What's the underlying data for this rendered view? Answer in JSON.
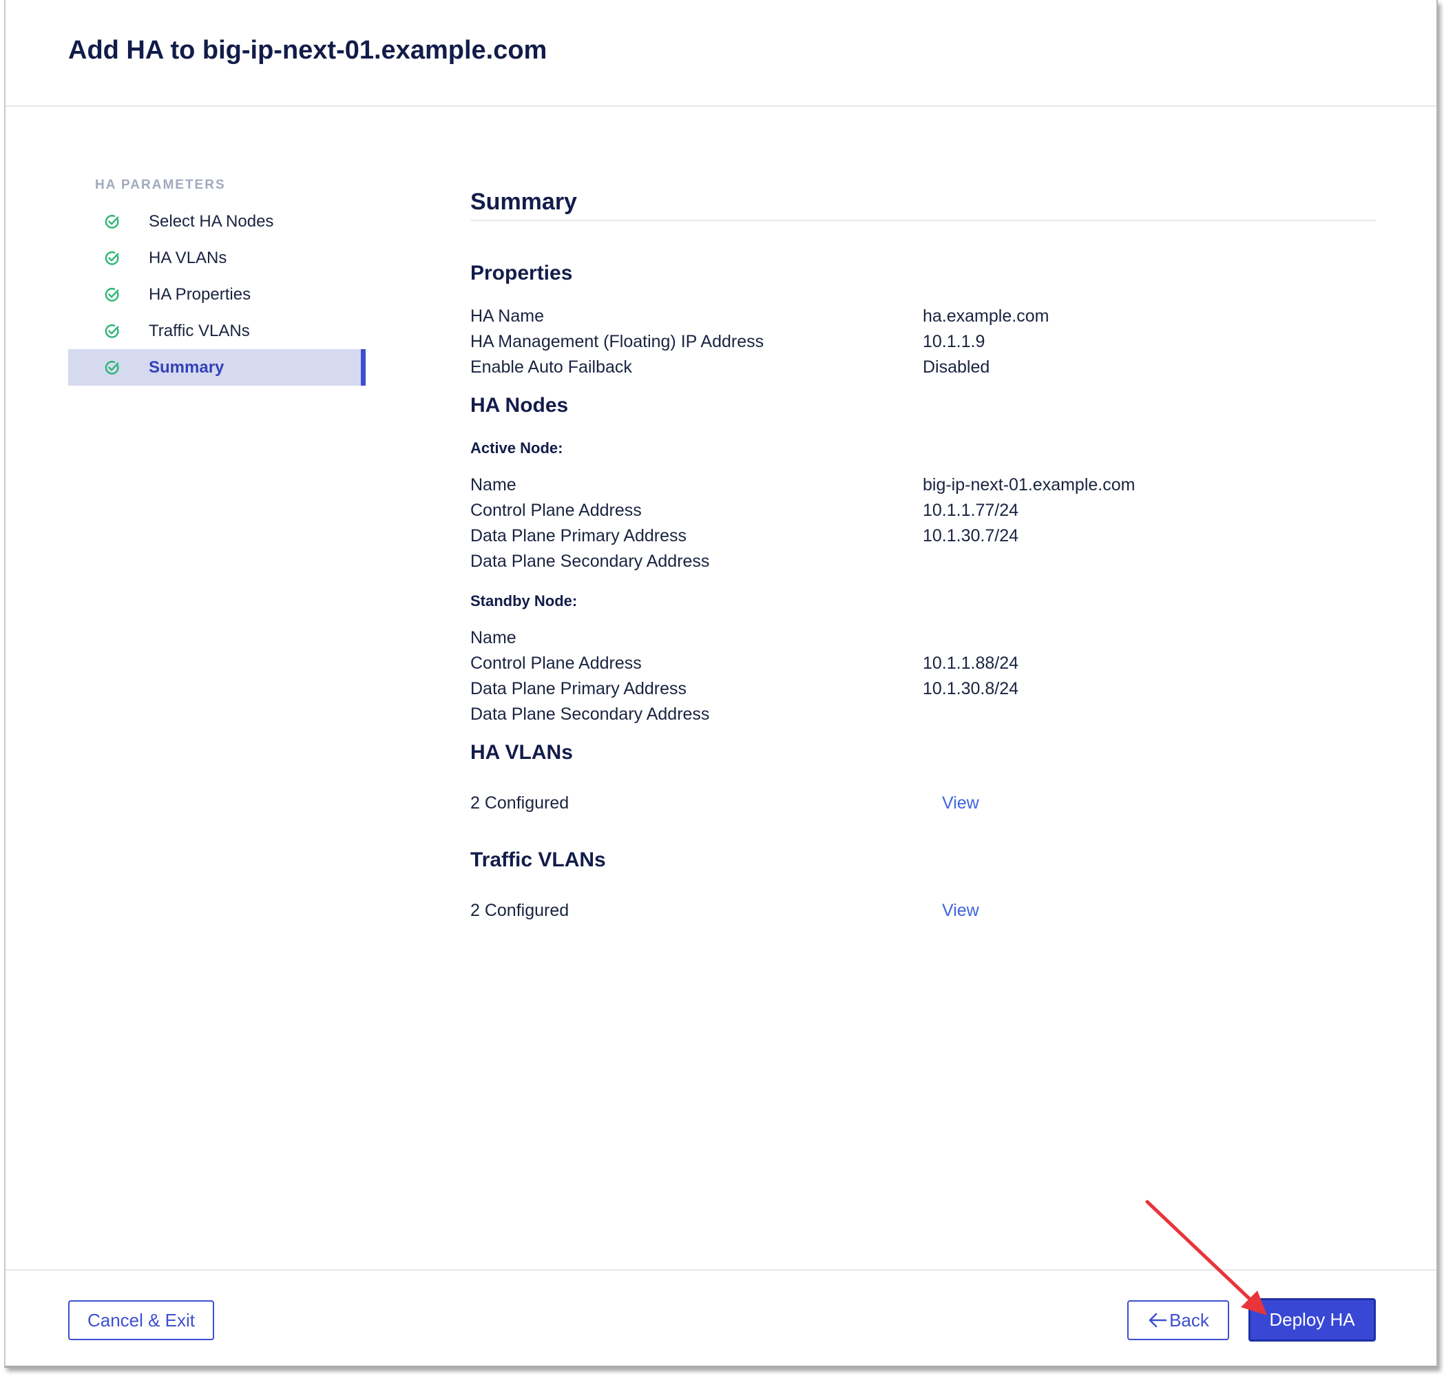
{
  "page_title": "Add HA to big-ip-next-01.example.com",
  "sidebar": {
    "heading": "HA PARAMETERS",
    "steps": [
      {
        "label": "Select HA Nodes",
        "status": "complete"
      },
      {
        "label": "HA VLANs",
        "status": "complete"
      },
      {
        "label": "HA Properties",
        "status": "complete"
      },
      {
        "label": "Traffic VLANs",
        "status": "complete"
      },
      {
        "label": "Summary",
        "status": "current"
      }
    ]
  },
  "summary": {
    "title": "Summary",
    "properties": {
      "title": "Properties",
      "rows": [
        {
          "label": "HA Name",
          "value": "ha.example.com"
        },
        {
          "label": "HA Management (Floating) IP Address",
          "value": "10.1.1.9"
        },
        {
          "label": "Enable Auto Failback",
          "value": "Disabled"
        }
      ]
    },
    "ha_nodes": {
      "title": "HA Nodes",
      "active": {
        "title": "Active Node:",
        "rows": [
          {
            "label": "Name",
            "value": "big-ip-next-01.example.com"
          },
          {
            "label": "Control Plane Address",
            "value": "10.1.1.77/24"
          },
          {
            "label": "Data Plane Primary Address",
            "value": "10.1.30.7/24"
          },
          {
            "label": "Data Plane Secondary Address",
            "value": ""
          }
        ]
      },
      "standby": {
        "title": "Standby Node:",
        "rows": [
          {
            "label": "Name",
            "value": ""
          },
          {
            "label": "Control Plane Address",
            "value": "10.1.1.88/24"
          },
          {
            "label": "Data Plane Primary Address",
            "value": "10.1.30.8/24"
          },
          {
            "label": "Data Plane Secondary Address",
            "value": ""
          }
        ]
      }
    },
    "ha_vlans": {
      "title": "HA VLANs",
      "count_text": "2 Configured",
      "link": "View"
    },
    "traffic_vlans": {
      "title": "Traffic VLANs",
      "count_text": "2 Configured",
      "link": "View"
    }
  },
  "footer": {
    "cancel_label": "Cancel & Exit",
    "back_label": "Back",
    "deploy_label": "Deploy HA"
  },
  "colors": {
    "accent": "#3d4fd1",
    "check": "#2bb673",
    "annotation_arrow": "#e8343a"
  }
}
